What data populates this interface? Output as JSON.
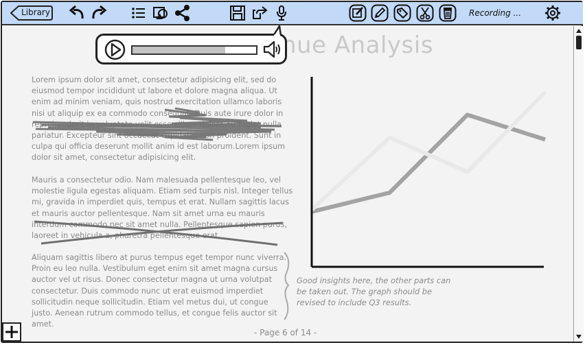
{
  "toolbar": {
    "library_label": "Library",
    "recording_label": "Recording ...",
    "buttons": [
      "undo",
      "redo",
      "list",
      "image",
      "share",
      "save",
      "export",
      "microphone",
      "edit-note",
      "pencil",
      "tag",
      "scissors",
      "trash",
      "settings"
    ]
  },
  "page": {
    "title": "nue Analysis",
    "paragraph1": "Lorem ipsum dolor sit amet, consectetur adipisicing elit, sed do eiusmod tempor incididunt ut labore et dolore magna aliqua. Ut enim ad minim veniam, quis nostrud exercitation ullamco laboris nisi ut aliquip ex ea commodo consequat. Duis aute irure dolor in reprehenderit in voluptate velit esse cillum dolore eu fugiat nulla pariatur. Excepteur sint occaecat cupidatat non proident. Sunt in culpa qui officia deserunt mollit anim id est laborum.Lorem ipsum dolor sit amet, consectetur adipisicing elit.",
    "paragraph2": "Mauris a consectetur odio. Nam malesuada pellentesque leo, vel molestie ligula egestas aliquam. Etiam sed turpis nisl. Integer tellus mi, gravida in imperdiet quis, tempus et erat. Nullam sagittis lacus et mauris auctor pellentesque. Nam sit amet urna eu mauris interdum commodo nec sit amet nulla. Pellentesque sapien purus, laoreet in vehicula a, pharetra pellentesque erat.",
    "paragraph3": "Aliquam sagittis libero at purus tempus eget tempor nunc viverra. Proin eu leo nulla. Vestibulum eget enim sit amet magna cursus auctor vel ut risus. Donec consectetur magna ut urna volutpat consectetur. Duis commodo nunc ut erat euismod imperdiet sollicitudin neque sollicitudin. Etiam vel metus dui, ut congue justo. Aenean rutrum commodo tellus, et congue felis auctor sit amet.",
    "annotation": "Good insights here, the other parts can be taken out.  The graph should be revised to include Q3 results.",
    "page_indicator": "- Page 6 of 14 -"
  },
  "audio_player": {
    "progress": 0.75
  },
  "chart_data": {
    "type": "line",
    "title": "",
    "xlabel": "",
    "ylabel": "",
    "x": [
      0,
      1,
      2,
      3
    ],
    "xlim": [
      0,
      3
    ],
    "ylim": [
      0,
      1
    ],
    "series": [
      {
        "values": [
          0.29,
          0.39,
          0.8,
          0.67
        ],
        "color": "#a3a3a3"
      },
      {
        "values": [
          0.3,
          0.68,
          0.5,
          0.92
        ],
        "color": "#e9e9e9"
      }
    ]
  },
  "colors": {
    "toolbar_bg": "#c2d9f7",
    "text_gray": "#8b8b8b",
    "title_gray": "#c9c9c9"
  }
}
